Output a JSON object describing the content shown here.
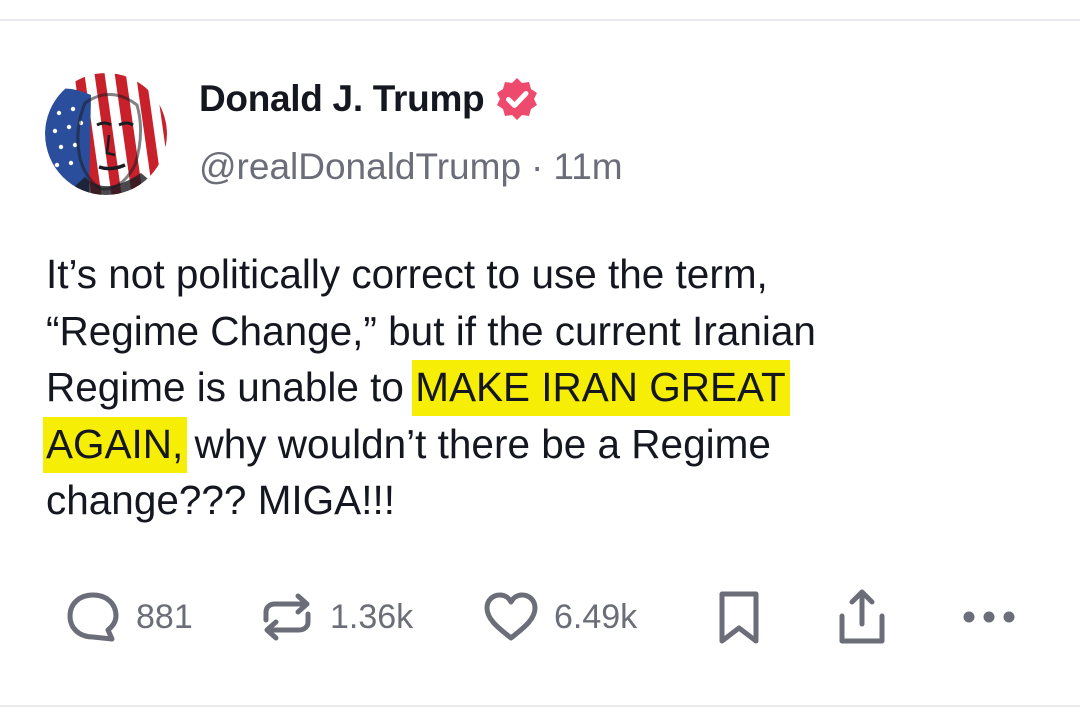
{
  "post": {
    "author": {
      "display_name": "Donald J. Trump",
      "handle": "@realDonaldTrump",
      "verified": true
    },
    "timestamp": "11m",
    "separator": "·",
    "text_lines": [
      "It’s not politically correct to use the term,",
      "“Regime Change,” but if the current Iranian",
      {
        "before": "Regime is unable to ",
        "highlight": "MAKE IRAN GREAT",
        "after": ""
      },
      {
        "before": "",
        "highlight": "AGAIN,",
        "after": " why wouldn’t there be a Regime"
      },
      "change??? MIGA!!!"
    ],
    "highlight_color": "#f7ee05"
  },
  "actions": {
    "replies": {
      "icon": "reply-bubble-icon",
      "count": "881"
    },
    "reposts": {
      "icon": "repost-icon",
      "count": "1.36k"
    },
    "likes": {
      "icon": "heart-icon",
      "count": "6.49k"
    },
    "bookmark": {
      "icon": "bookmark-icon"
    },
    "share": {
      "icon": "share-icon"
    },
    "more": {
      "icon": "more-dots-icon"
    }
  },
  "colors": {
    "text": "#14171f",
    "muted": "#6b6d78",
    "verified_badge": "#ee4a6d",
    "divider": "#e9eaee"
  }
}
